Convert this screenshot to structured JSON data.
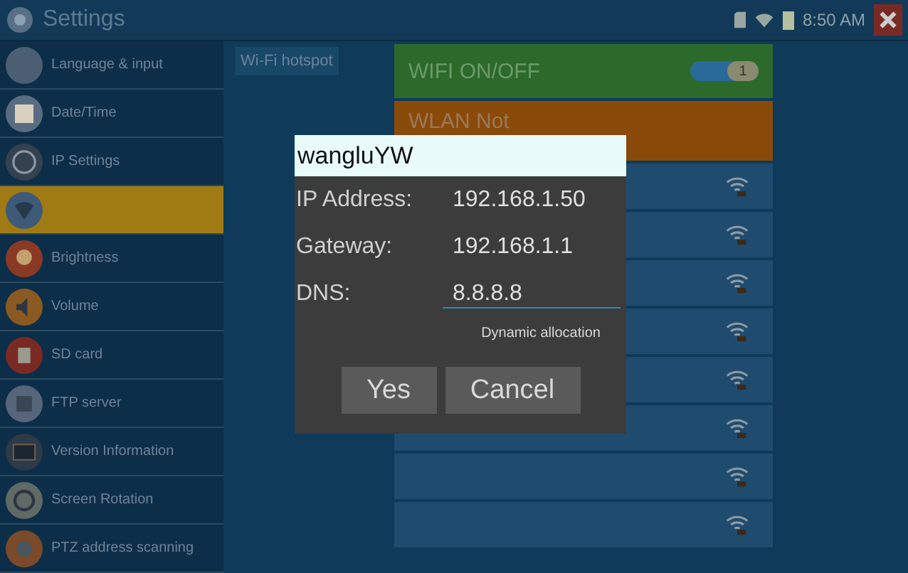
{
  "window": {
    "title": "Settings"
  },
  "status_bar": {
    "time": "8:50 AM"
  },
  "sidebar": {
    "items": [
      {
        "label": "Language & input",
        "selected": false
      },
      {
        "label": "Date/Time",
        "selected": false
      },
      {
        "label": "IP Settings",
        "selected": false
      },
      {
        "selected": true
      },
      {
        "label": "Brightness",
        "selected": false
      },
      {
        "label": "Volume",
        "selected": false
      },
      {
        "label": "SD card",
        "selected": false
      },
      {
        "label": "FTP server",
        "selected": false
      },
      {
        "label": "Version Information",
        "selected": false
      },
      {
        "label": "Screen Rotation",
        "selected": false
      },
      {
        "label": "PTZ address scanning",
        "selected": false
      }
    ]
  },
  "tab": {
    "label": "Wi-Fi hotspot"
  },
  "wifi_toggle": {
    "label": "WIFI ON/OFF",
    "on": true,
    "knob": "1"
  },
  "wlan_banner": {
    "label": "WLAN Not"
  },
  "dialog": {
    "title": "wangluYW",
    "fields": [
      {
        "label": "IP Address:",
        "value": "192.168.1.50",
        "editing": false
      },
      {
        "label": "Gateway:",
        "value": "192.168.1.1",
        "editing": false
      },
      {
        "label": "DNS:",
        "value": "8.8.8.8",
        "editing": true
      }
    ],
    "link": "Dynamic allocation",
    "buttons": [
      "Yes",
      "Cancel"
    ]
  }
}
